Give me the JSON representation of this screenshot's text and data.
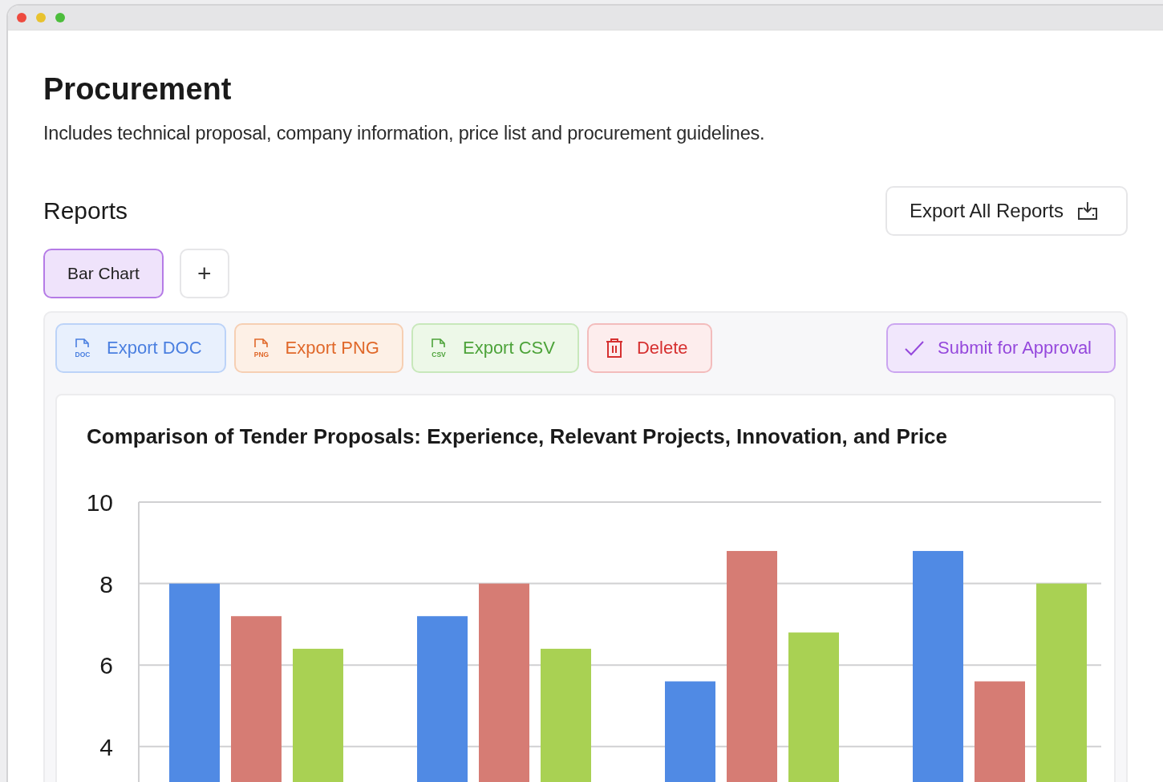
{
  "page": {
    "title": "Procurement",
    "description": "Includes technical proposal, company information, price list and procurement guidelines."
  },
  "reports": {
    "heading": "Reports",
    "export_all": "Export All Reports"
  },
  "tabs": [
    {
      "label": "Bar Chart",
      "selected": true
    }
  ],
  "add_tab": "+",
  "actions": [
    {
      "kind": "doc",
      "label": "Export DOC",
      "icon_text": "DOC"
    },
    {
      "kind": "png",
      "label": "Export PNG",
      "icon_text": "PNG"
    },
    {
      "kind": "csv",
      "label": "Export CSV",
      "icon_text": "CSV"
    },
    {
      "kind": "delete",
      "label": "Delete"
    },
    {
      "kind": "submit",
      "label": "Submit for Approval"
    }
  ],
  "chart": {
    "chart_data": {
      "type": "bar",
      "grid": true,
      "title": "Comparison of Tender Proposals: Experience, Relevant Projects, Innovation, and Price",
      "ylim": [
        0,
        10
      ],
      "yticks": [
        4,
        6,
        8,
        10
      ],
      "series": [
        {
          "color": "#508ae4",
          "values": [
            8,
            7.2,
            5.6,
            8.8
          ]
        },
        {
          "color": "#d67c74",
          "values": [
            7.2,
            8,
            8.8,
            5.6
          ]
        },
        {
          "color": "#a9d153",
          "values": [
            6.4,
            6.4,
            6.8,
            8
          ]
        }
      ]
    }
  }
}
